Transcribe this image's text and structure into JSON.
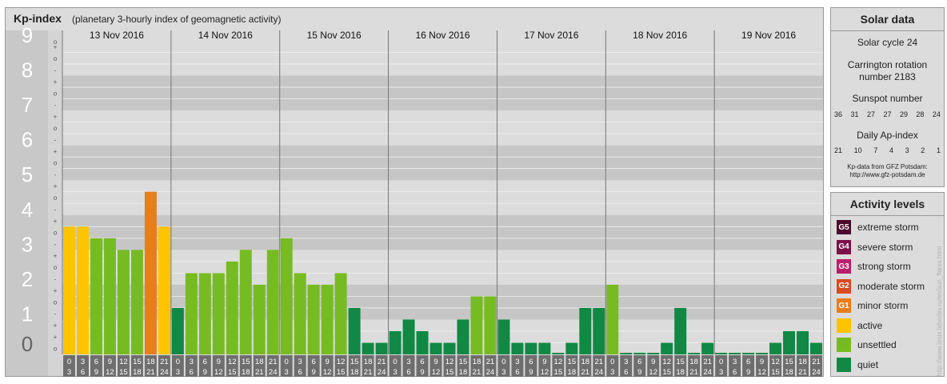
{
  "header": {
    "title": "Kp-index",
    "subtitle": "(planetary 3-hourly index of geomagnetic activity)"
  },
  "chart_data": {
    "type": "bar",
    "y_ticks": [
      "0",
      "1",
      "2",
      "3",
      "4",
      "5",
      "6",
      "7",
      "8",
      "9"
    ],
    "minor_marks": [
      "+",
      "o",
      "-"
    ],
    "ylim": [
      0,
      9
    ],
    "days": [
      "13 Nov 2016",
      "14 Nov 2016",
      "15 Nov 2016",
      "16 Nov 2016",
      "17 Nov 2016",
      "18 Nov 2016",
      "19 Nov 2016"
    ],
    "hour_labels_top": [
      "0",
      "3",
      "6",
      "9",
      "12",
      "15",
      "18",
      "21"
    ],
    "hour_labels_bottom": [
      "3",
      "6",
      "9",
      "12",
      "15",
      "18",
      "21",
      "24"
    ],
    "values": [
      3.667,
      3.667,
      3.333,
      3.333,
      3,
      3,
      4.667,
      3.667,
      1.333,
      2.333,
      2.333,
      2.333,
      2.667,
      3,
      2,
      3,
      3.333,
      2.333,
      2,
      2,
      2.333,
      1.333,
      0.333,
      0.333,
      0.667,
      1,
      0.667,
      0.333,
      0.333,
      1,
      1.667,
      1.667,
      1,
      0.333,
      0.333,
      0.333,
      0,
      0.333,
      1.333,
      1.333,
      2,
      0,
      0,
      0,
      0.333,
      1.333,
      0,
      0.333,
      0,
      0,
      0,
      0,
      0.333,
      0.667,
      0.667,
      0.333
    ],
    "colors": {
      "quiet": "#118844",
      "unsettled": "#77bb22",
      "active": "#ffc400",
      "minor_storm": "#e67e1a",
      "moderate_storm": "#d94a1e",
      "strong_storm": "#bb1f6a",
      "severe_storm": "#7a1049",
      "extreme_storm": "#4a0a2a"
    },
    "grid": true,
    "legend_position": "right"
  },
  "solar": {
    "heading": "Solar data",
    "cycle": "Solar cycle 24",
    "carrington_line1": "Carrington rotation",
    "carrington_line2": "number 2183",
    "sunspot_title": "Sunspot number",
    "sunspot_values": [
      "36",
      "31",
      "27",
      "27",
      "29",
      "28",
      "24"
    ],
    "ap_title": "Daily Ap-index",
    "ap_values": [
      "21",
      "10",
      "7",
      "4",
      "3",
      "2",
      "1"
    ],
    "source_line1": "Kp-data from GFZ Potsdam:",
    "source_line2": "http://www.gfz-potsdam.de"
  },
  "levels": {
    "heading": "Activity levels",
    "items": [
      {
        "badge": "G5",
        "label": "extreme storm",
        "color": "#4a0a2a"
      },
      {
        "badge": "G4",
        "label": "severe storm",
        "color": "#7a1049"
      },
      {
        "badge": "G3",
        "label": "strong storm",
        "color": "#bb1f6a"
      },
      {
        "badge": "G2",
        "label": "moderate storm",
        "color": "#d94a1e"
      },
      {
        "badge": "G1",
        "label": "minor storm",
        "color": "#e67e1a"
      },
      {
        "badge": "",
        "label": "active",
        "color": "#ffc400"
      },
      {
        "badge": "",
        "label": "unsettled",
        "color": "#77bb22"
      },
      {
        "badge": "",
        "label": "quiet",
        "color": "#118844"
      }
    ]
  },
  "watermark": "http://www.tesis.lebedev.ru/en/sun_flares.html"
}
